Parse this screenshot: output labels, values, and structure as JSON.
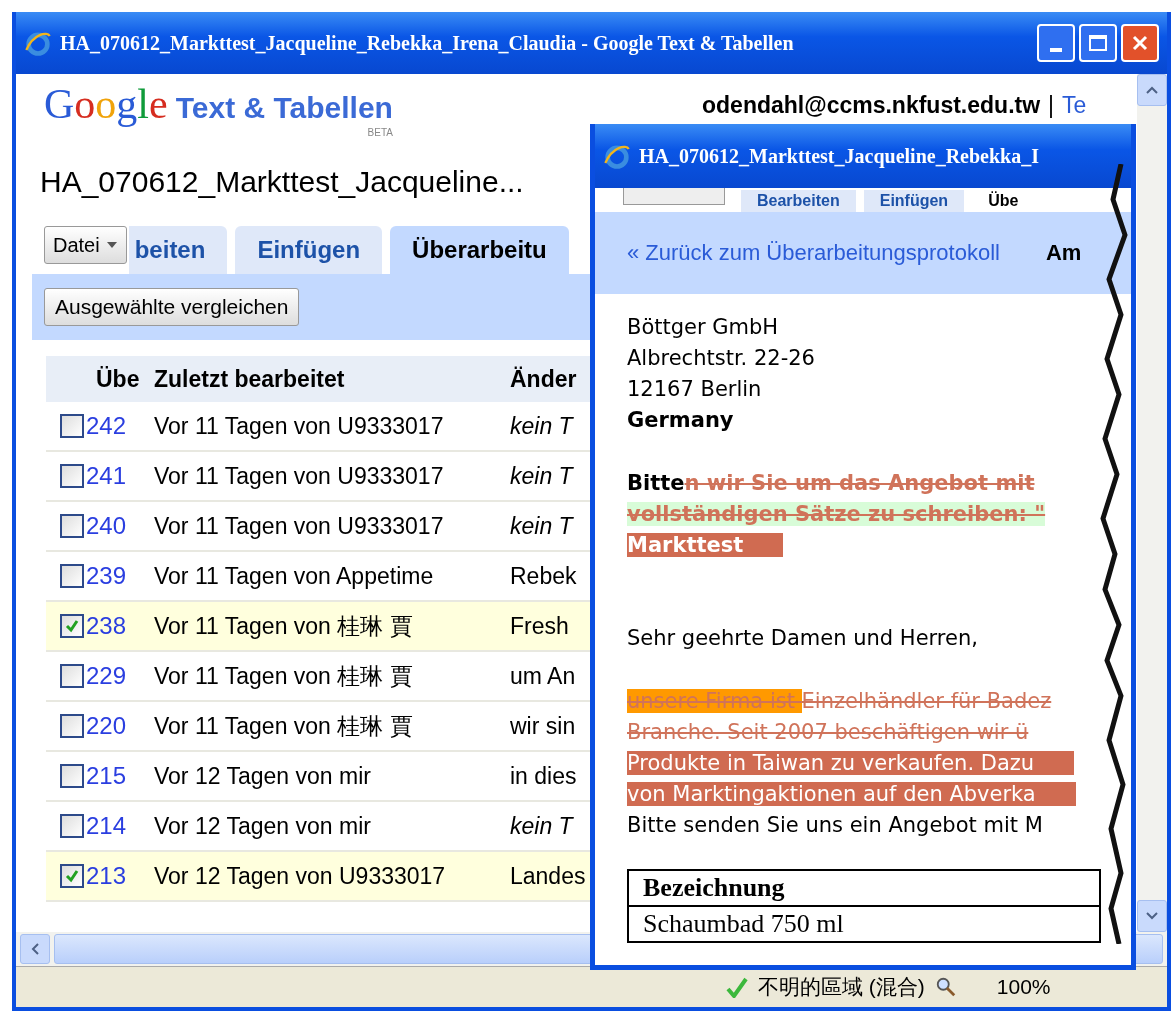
{
  "main_window": {
    "title": "HA_070612_Markttest_Jacqueline_Rebekka_Irena_Claudia - Google Text & Tabellen"
  },
  "header": {
    "logo_google": "Google",
    "logo_product": "Text & Tabellen",
    "logo_badge": "BETA",
    "user_email": "odendahl@ccms.nkfust.edu.tw",
    "separator": "|",
    "link": "Te"
  },
  "document_title": "HA_070612_Markttest_Jacqueline...",
  "file_menu": "Datei",
  "tabs": [
    {
      "label": "beiten",
      "selected": false
    },
    {
      "label": "Einfügen",
      "selected": false
    },
    {
      "label": "Überarbeitu",
      "selected": true
    }
  ],
  "compare_button": "Ausgewählte vergleichen",
  "revisions": {
    "columns": [
      "Übe",
      "Zuletzt bearbeitet",
      "Änder"
    ],
    "rows": [
      {
        "checked": false,
        "number": "242",
        "edited": "Vor 11 Tagen von U9333017",
        "change": "kein T",
        "italic": true
      },
      {
        "checked": false,
        "number": "241",
        "edited": "Vor 11 Tagen von U9333017",
        "change": "kein T",
        "italic": true
      },
      {
        "checked": false,
        "number": "240",
        "edited": "Vor 11 Tagen von U9333017",
        "change": "kein T",
        "italic": true
      },
      {
        "checked": false,
        "number": "239",
        "edited": "Vor 11 Tagen von Appetime",
        "change": "Rebek",
        "italic": false
      },
      {
        "checked": true,
        "number": "238",
        "edited": "Vor 11 Tagen von 桂琳 賈",
        "change": "Fresh",
        "italic": false
      },
      {
        "checked": false,
        "number": "229",
        "edited": "Vor 11 Tagen von 桂琳 賈",
        "change": "um An",
        "italic": false
      },
      {
        "checked": false,
        "number": "220",
        "edited": "Vor 11 Tagen von 桂琳 賈",
        "change": "wir sin",
        "italic": false
      },
      {
        "checked": false,
        "number": "215",
        "edited": "Vor 12 Tagen von mir",
        "change": "in dies",
        "italic": false
      },
      {
        "checked": false,
        "number": "214",
        "edited": "Vor 12 Tagen von mir",
        "change": "kein T",
        "italic": true
      },
      {
        "checked": true,
        "number": "213",
        "edited": "Vor 12 Tagen von U9333017",
        "change": "Landes",
        "italic": false
      }
    ]
  },
  "status_bar": {
    "zone": "不明的區域 (混合)",
    "zoom": "100%"
  },
  "popup": {
    "title": "HA_070612_Markttest_Jacqueline_Rebekka_I",
    "tabs": [
      {
        "label": "Bearbeiten",
        "selected": false
      },
      {
        "label": "Einfügen",
        "selected": false
      },
      {
        "label": "Übe",
        "selected": true
      }
    ],
    "back_link": "« Zurück zum Überarbeitungsprotokoll",
    "section_label": "Am",
    "paragraphs": [
      [
        [
          {
            "text": "Böttger GmbH",
            "kind": "normal",
            "bold": false
          }
        ],
        [
          {
            "text": "Albrechtstr. 22-26",
            "kind": "normal",
            "bold": false
          }
        ],
        [
          {
            "text": "12167 Berlin",
            "kind": "normal",
            "bold": false
          }
        ],
        [
          {
            "text": "Germany",
            "kind": "normal",
            "bold": true
          }
        ]
      ],
      [
        [
          {
            "text": "Bitte",
            "kind": "normal",
            "bold": true
          },
          {
            "text": "n wir Sie um das Angebot mit",
            "kind": "deleted",
            "bold": true
          }
        ],
        [
          {
            "text": "vollständigen Sätze zu schreiben: \"",
            "kind": "deleted",
            "bold": true,
            "color": "#d8fcd8"
          }
        ],
        [
          {
            "text": "Markttest",
            "kind": "inserted",
            "bold": true
          }
        ]
      ],
      [
        [
          {
            "text": "Sehr geehrte Damen und Herren,",
            "kind": "normal",
            "bold": false
          }
        ]
      ],
      [
        [
          {
            "text": "unsere Firma ist ",
            "kind": "deleted",
            "bold": false,
            "color": "#ff9900"
          },
          {
            "text": "Einzelhändler für Badez",
            "kind": "deleted",
            "bold": false
          }
        ],
        [
          {
            "text": "Branche. Seit 2007 beschäftigen wir ü",
            "kind": "deleted",
            "bold": false
          }
        ],
        [
          {
            "text": "Produkte in Taiwan zu verkaufen. Dazu",
            "kind": "inserted",
            "bold": false
          }
        ],
        [
          {
            "text": "von Marktingaktionen auf den Abverka",
            "kind": "inserted",
            "bold": false
          }
        ],
        [
          {
            "text": "Bitte senden Sie uns ein Angebot mit M",
            "kind": "normal",
            "bold": false
          }
        ]
      ]
    ],
    "table": {
      "header": "Bezeichnung",
      "rows": [
        "Schaumbad 750 ml"
      ]
    }
  }
}
